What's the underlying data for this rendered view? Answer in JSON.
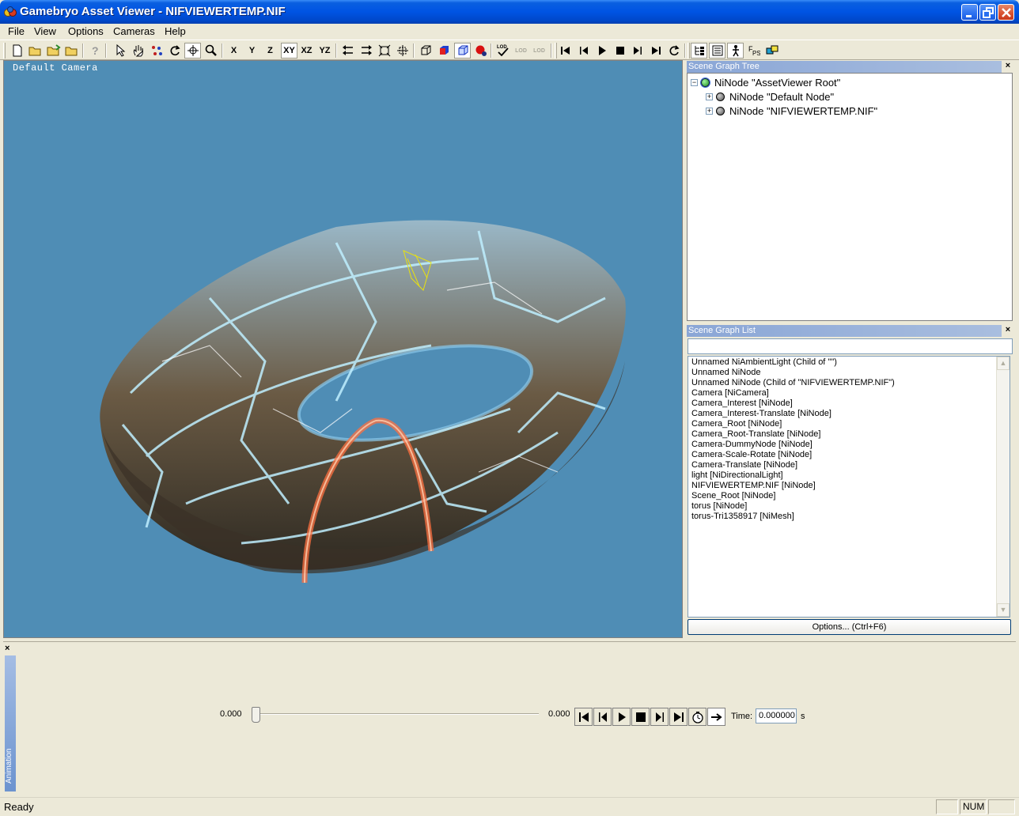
{
  "window": {
    "title": "Gamebryo Asset Viewer - NIFVIEWERTEMP.NIF",
    "controls": [
      "minimize-icon",
      "maximize-icon",
      "close-icon"
    ]
  },
  "menu": {
    "items": [
      "File",
      "View",
      "Options",
      "Cameras",
      "Help"
    ]
  },
  "toolbar": {
    "axis_buttons": [
      "X",
      "Y",
      "Z",
      "XY",
      "XZ",
      "YZ"
    ],
    "lod_buttons": [
      "LOD",
      "LOD",
      "LOD"
    ]
  },
  "viewport": {
    "camera_label": "Default Camera",
    "background": "#4f8db5"
  },
  "scene_graph_tree": {
    "title": "Scene Graph Tree",
    "close": "×",
    "nodes": [
      {
        "label": "NiNode \"AssetViewer Root\"",
        "expander": "−"
      },
      {
        "label": "NiNode \"Default Node\"",
        "expander": "+"
      },
      {
        "label": "NiNode \"NIFVIEWERTEMP.NIF\"",
        "expander": "+"
      }
    ]
  },
  "scene_graph_list": {
    "title": "Scene Graph List",
    "close": "×",
    "filter_value": "",
    "items": [
      " Unnamed NiAmbientLight (Child of \"\")",
      " Unnamed NiNode",
      " Unnamed NiNode (Child of \"NIFVIEWERTEMP.NIF\")",
      "Camera [NiCamera]",
      "Camera_Interest [NiNode]",
      "Camera_Interest-Translate [NiNode]",
      "Camera_Root [NiNode]",
      "Camera_Root-Translate [NiNode]",
      "Camera-DummyNode [NiNode]",
      "Camera-Scale-Rotate [NiNode]",
      "Camera-Translate [NiNode]",
      "light [NiDirectionalLight]",
      "NIFVIEWERTEMP.NIF [NiNode]",
      "Scene_Root [NiNode]",
      "torus [NiNode]",
      "torus-Tri1358917 [NiMesh]"
    ],
    "options_button": "Options... (Ctrl+F6)"
  },
  "animation": {
    "panel_label": "Animation",
    "close": "×",
    "start_value": "0.000",
    "end_value": "0.000",
    "slider_position": 0,
    "time_label": "Time:",
    "time_value": "0.000000",
    "time_unit": "s"
  },
  "status": {
    "text": "Ready",
    "num_indicator": "NUM"
  }
}
